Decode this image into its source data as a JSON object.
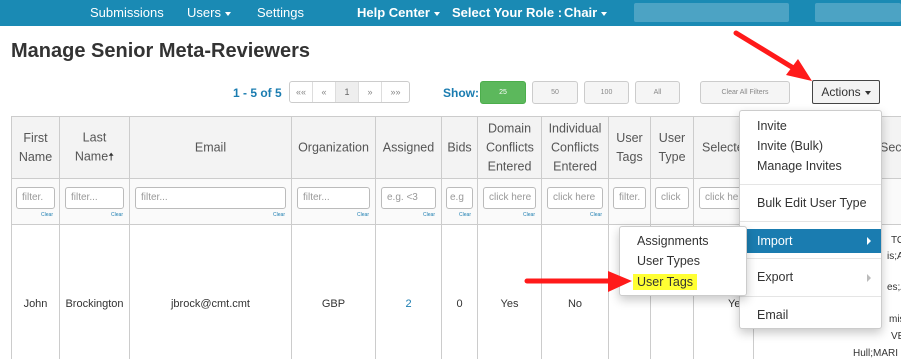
{
  "nav": {
    "submissions": "Submissions",
    "users": "Users",
    "settings": "Settings",
    "help_center": "Help Center",
    "select_role_label": "Select Your Role :",
    "role": "Chair"
  },
  "page_title": "Manage Senior Meta-Reviewers",
  "pagination": {
    "count_text": "1 - 5 of 5",
    "first": "««",
    "prev": "«",
    "page": "1",
    "next": "»",
    "last": "»»",
    "show_label": "Show:",
    "sizes": [
      "25",
      "50",
      "100",
      "All"
    ],
    "selected_size": "25",
    "clear_filters": "Clear All Filters"
  },
  "actions_label": "Actions",
  "table": {
    "headers": {
      "first_name": "First Name",
      "last_name": "Last Name",
      "email": "Email",
      "organization": "Organization",
      "assigned": "Assigned",
      "bids": "Bids",
      "domain_conflicts": "Domain Conflicts Entered",
      "individual_conflicts": "Individual Conflicts Entered",
      "user_tags": "User Tags",
      "user_type": "User Type",
      "selected": "Selecte",
      "sec": "Sec"
    },
    "filters": {
      "first_name": "filter.",
      "last_name": "filter...",
      "email": "filter...",
      "organization": "filter...",
      "assigned": "e.g. <3",
      "bids": "e.g",
      "domain_conflicts": "click here",
      "individual_conflicts": "click here",
      "user_tags": "filter.",
      "user_type": "click",
      "selected": "click he"
    },
    "clear_label": "Clear",
    "row": {
      "first_name": "John",
      "last_name": "Brockington",
      "email": "jbrock@cmt.cmt",
      "organization": "GBP",
      "assigned": "2",
      "bids": "0",
      "domain_conflicts": "Yes",
      "individual_conflicts": "No",
      "selected": "Yes"
    },
    "overflow_fragments": [
      "TOM",
      "is;A",
      "es;A",
      "miss",
      "VESS",
      "Hull;MARI"
    ]
  },
  "actions_menu": {
    "invite": "Invite",
    "invite_bulk": "Invite (Bulk)",
    "manage_invites": "Manage Invites",
    "bulk_edit_user_type": "Bulk Edit User Type",
    "import": "Import",
    "export": "Export",
    "email": "Email"
  },
  "import_submenu": {
    "assignments": "Assignments",
    "user_types": "User Types",
    "user_tags": "User Tags"
  },
  "colors": {
    "navbar": "#1a8ab4",
    "link_blue": "#1a7cb0",
    "active_menu": "#1a7cb0",
    "show_25_green": "#5cb85c",
    "highlight_yellow": "#ffff33",
    "annotation_arrow": "#ff1a1a"
  },
  "icons": {
    "sort": "sort-up-arrow-icon",
    "submenu": "chevron-right-icon",
    "dropdown": "caret-down-icon"
  }
}
